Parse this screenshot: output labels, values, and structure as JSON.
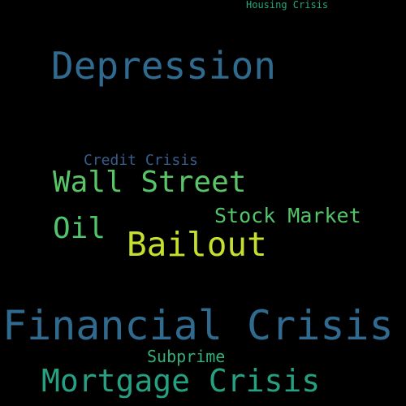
{
  "words": [
    {
      "text": "Housing Crisis",
      "color": "#27a57f"
    },
    {
      "text": "Depression",
      "color": "#306a8f"
    },
    {
      "text": "Credit Crisis",
      "color": "#375e8c"
    },
    {
      "text": "Wall Street",
      "color": "#5ac567"
    },
    {
      "text": "Stock Market",
      "color": "#52c469"
    },
    {
      "text": "Oil",
      "color": "#52c469"
    },
    {
      "text": "Bailout",
      "color": "#c7df2d"
    },
    {
      "text": "Financial Crisis",
      "color": "#306a8f"
    },
    {
      "text": "Subprime",
      "color": "#33b07a"
    },
    {
      "text": "Mortgage Crisis",
      "color": "#27a082"
    }
  ]
}
